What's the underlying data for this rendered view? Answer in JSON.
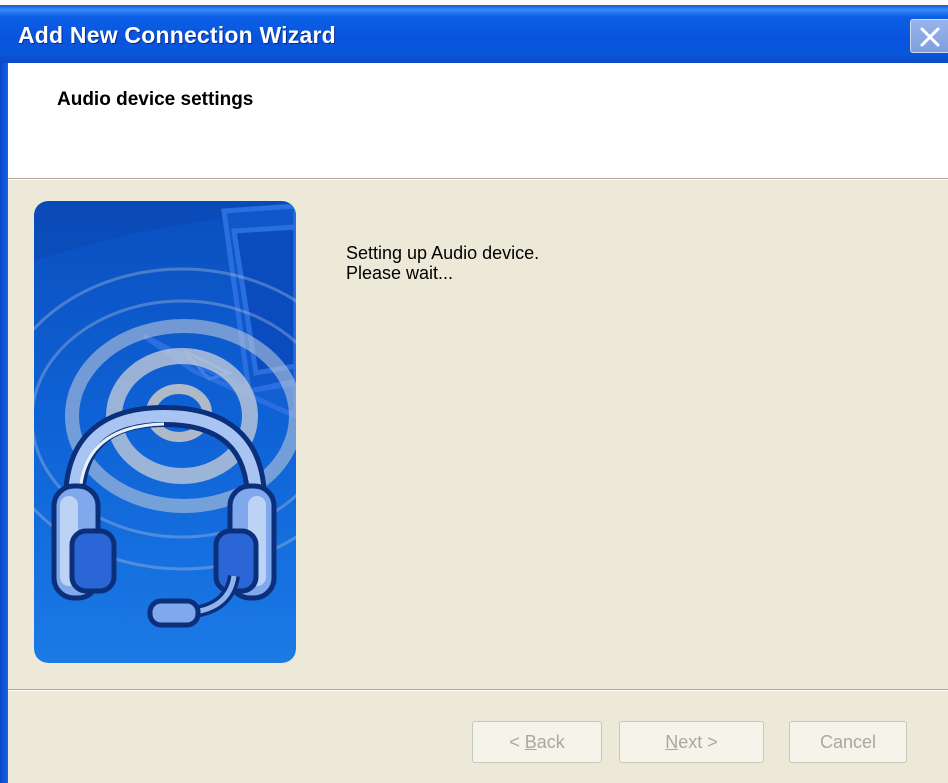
{
  "window": {
    "title": "Add New Connection Wizard"
  },
  "header": {
    "title": "Audio device settings"
  },
  "status": {
    "line1": "Setting up Audio device.",
    "line2": "Please wait..."
  },
  "buttons": {
    "back": {
      "mnemonic": "B",
      "rest": "ack",
      "prefix": "< "
    },
    "next": {
      "mnemonic": "N",
      "rest": "ext",
      "suffix": " >"
    },
    "cancel": {
      "label": "Cancel"
    }
  },
  "icons": {
    "close": "close-icon",
    "illustration": "headset-laptop-illustration"
  },
  "colors": {
    "titlebar": "#0854dd",
    "face": "#ece9d8",
    "disabled_text": "#aca899",
    "illustration_bg": "#0a54c8"
  }
}
